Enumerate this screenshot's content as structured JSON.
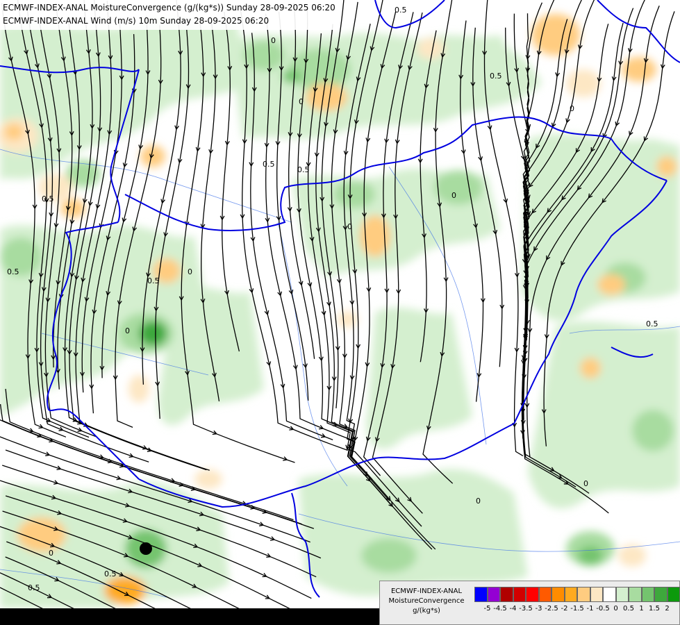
{
  "titles": {
    "line1": "ECMWF-INDEX-ANAL MoistureConvergence (g/(kg*s)) Sunday 28-09-2025 06:20",
    "line2": "ECMWF-INDEX-ANAL Wind (m/s) 10m Sunday 28-09-2025 06:20"
  },
  "legend": {
    "title1": "ECMWF-INDEX-ANAL",
    "title2": "MoistureConvergence",
    "units": "g/(kg*s)",
    "colors": [
      "#0000ff",
      "#9400d3",
      "#b00000",
      "#d20000",
      "#ff0000",
      "#ff5a00",
      "#ff8c00",
      "#ffaa20",
      "#ffcc80",
      "#fde7c4",
      "#ffffff",
      "#d4efcf",
      "#a8dca0",
      "#74c46e",
      "#3ea83c",
      "#0c9a0c"
    ],
    "tick_labels": [
      "-5",
      "-4.5",
      "-4",
      "-3.5",
      "-3",
      "-2.5",
      "-2",
      "-1.5",
      "-1",
      "-0.5",
      "0",
      "0.5",
      "1",
      "1.5",
      "2"
    ]
  },
  "contour_labels": [
    "0.5",
    "0",
    "0.5",
    "0",
    "0.5",
    "0",
    "0.5",
    "0",
    "0.5",
    "0",
    "0.5",
    "0",
    "0.5",
    "0",
    "0.5",
    "0",
    "0.5",
    "0",
    "0.5",
    "0"
  ],
  "colors": {
    "border": "#0000e0",
    "river": "#3a6ee8",
    "streamline": "#000000",
    "green_light": "#d4efcf",
    "green_mid": "#a8dca0",
    "green_dark": "#3ea83c",
    "orange_light": "#fde7c4",
    "orange_mid": "#ffcc80"
  }
}
